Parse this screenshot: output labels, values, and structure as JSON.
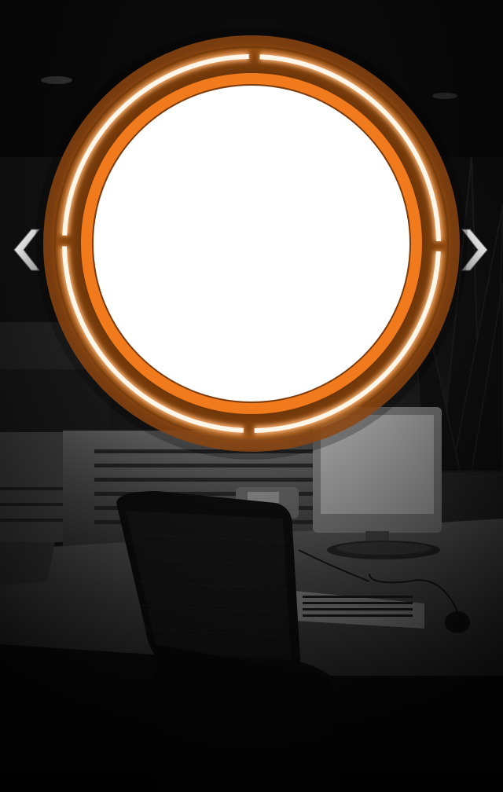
{
  "carousel": {
    "prev_icon": "chevron-left-icon",
    "next_icon": "chevron-right-icon",
    "ring_color": "#f07a1c",
    "ring_glow_color": "#ffd9b0",
    "center_fill": "#ffffff"
  },
  "background": {
    "scene": "office-desk-photo",
    "tone": "grayscale"
  }
}
